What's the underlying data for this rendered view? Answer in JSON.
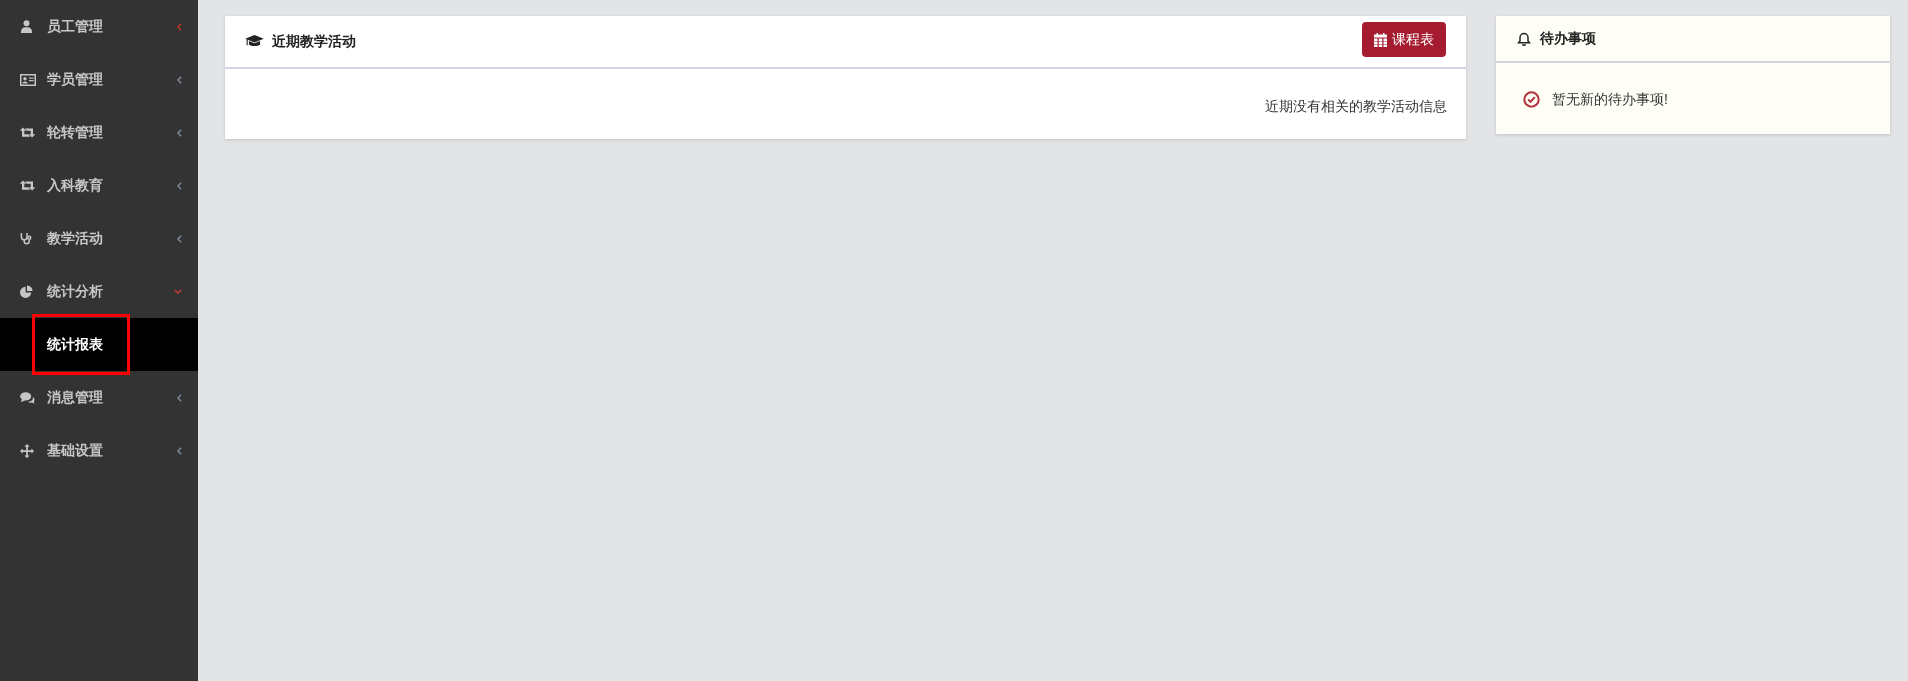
{
  "sidebar": {
    "items": [
      {
        "label": "员工管理",
        "expanded": false,
        "active": true
      },
      {
        "label": "学员管理",
        "expanded": false,
        "active": false
      },
      {
        "label": "轮转管理",
        "expanded": false,
        "active": false
      },
      {
        "label": "入科教育",
        "expanded": false,
        "active": false
      },
      {
        "label": "教学活动",
        "expanded": false,
        "active": false
      },
      {
        "label": "统计分析",
        "expanded": true,
        "active": true,
        "children": [
          {
            "label": "统计报表",
            "selected": true,
            "highlighted": true
          }
        ]
      },
      {
        "label": "消息管理",
        "expanded": false,
        "active": false
      },
      {
        "label": "基础设置",
        "expanded": false,
        "active": false
      }
    ]
  },
  "activity_panel": {
    "title": "近期教学活动",
    "button": "课程表",
    "empty_message": "近期没有相关的教学活动信息"
  },
  "todo_panel": {
    "title": "待办事项",
    "empty_message": "暂无新的待办事项!"
  }
}
